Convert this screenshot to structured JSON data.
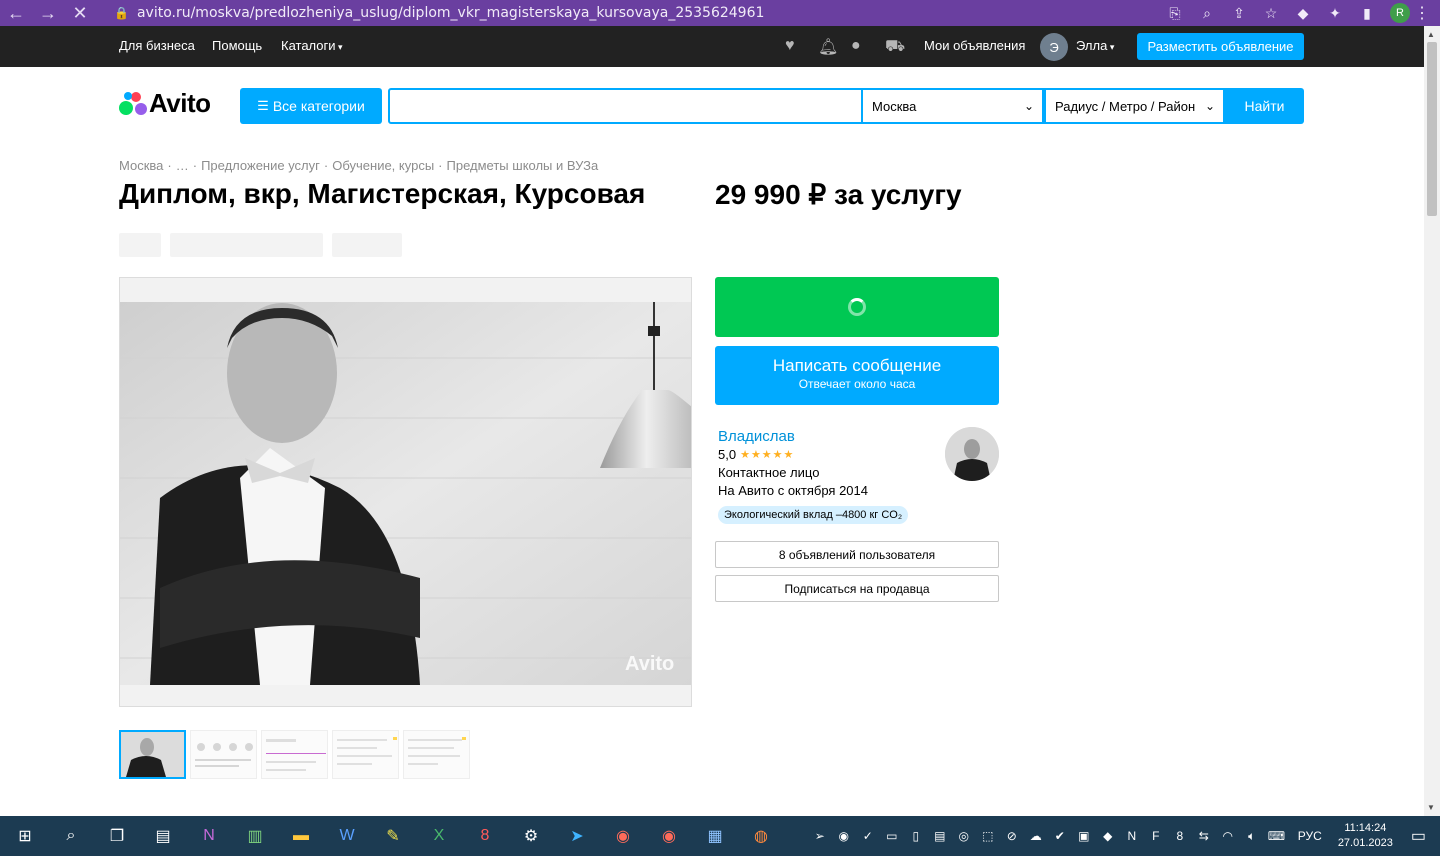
{
  "browser": {
    "url": "avito.ru/moskva/predlozheniya_uslug/diplom_vkr_magisterskaya_kursovaya_2535624961",
    "profile_letter": "R"
  },
  "topbar": {
    "links": [
      "Для бизнеса",
      "Помощь",
      "Каталоги"
    ],
    "my_ads": "Мои объявления",
    "user_initial": "Э",
    "user_name": "Элла",
    "post_button": "Разместить объявление"
  },
  "header": {
    "logo_text": "Avito",
    "categories_button": "Все категории",
    "search_value": "",
    "city": "Москва",
    "radius": "Радиус / Метро / Район",
    "find_button": "Найти"
  },
  "breadcrumbs": [
    "Москва",
    "…",
    "Предложение услуг",
    "Обучение, курсы",
    "Предметы школы и ВУЗа"
  ],
  "listing": {
    "title": "Диплом, вкр, Магистерская, Курсовая",
    "price": "29 990 ₽ за услугу"
  },
  "actions": {
    "message_main": "Написать сообщение",
    "message_sub": "Отвечает около часа",
    "other_ads": "8 объявлений пользователя",
    "subscribe": "Подписаться на продавца"
  },
  "seller": {
    "name": "Владислав",
    "rating": "5,0",
    "stars": "★★★★★",
    "role": "Контактное лицо",
    "since": "На Авито с октября 2014",
    "eco": "Экологический вклад –4800 кг CO₂"
  },
  "photo": {
    "watermark": "Avito"
  },
  "taskbar": {
    "language": "РУС",
    "time": "11:14:24",
    "date": "27.01.2023"
  },
  "colors": {
    "accent": "#00aaff",
    "green": "#00c853",
    "topbar": "#222222",
    "browser": "#6a3fa0"
  }
}
